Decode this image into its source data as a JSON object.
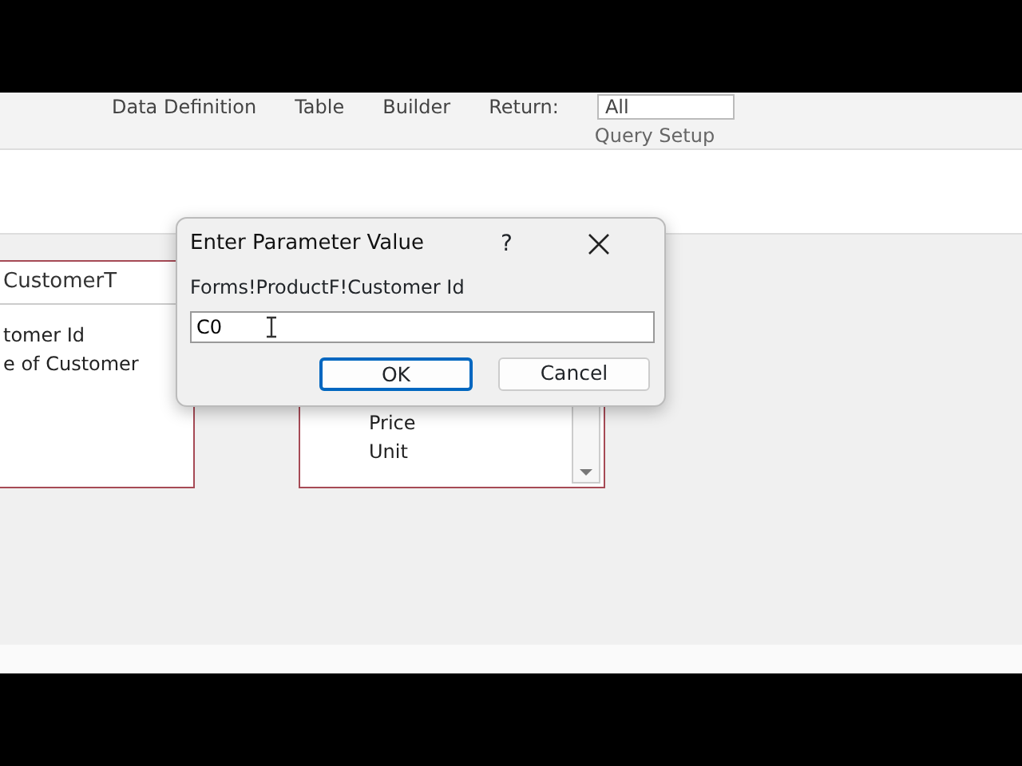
{
  "ribbon": {
    "items": [
      "Data Definition",
      "Table",
      "Builder",
      "Return:"
    ],
    "return_value": "All",
    "group_label": "Query Setup"
  },
  "tables": [
    {
      "title": "CustomerT",
      "fields": [
        "tomer Id",
        "e of Customer"
      ]
    },
    {
      "fields": [
        "Price",
        "Unit"
      ]
    }
  ],
  "dialog": {
    "title": "Enter Parameter Value",
    "help": "?",
    "prompt": "Forms!ProductF!Customer Id",
    "value": "C0",
    "buttons": [
      {
        "label": "OK",
        "selected": true
      },
      {
        "label": "Cancel",
        "selected": false
      }
    ]
  }
}
